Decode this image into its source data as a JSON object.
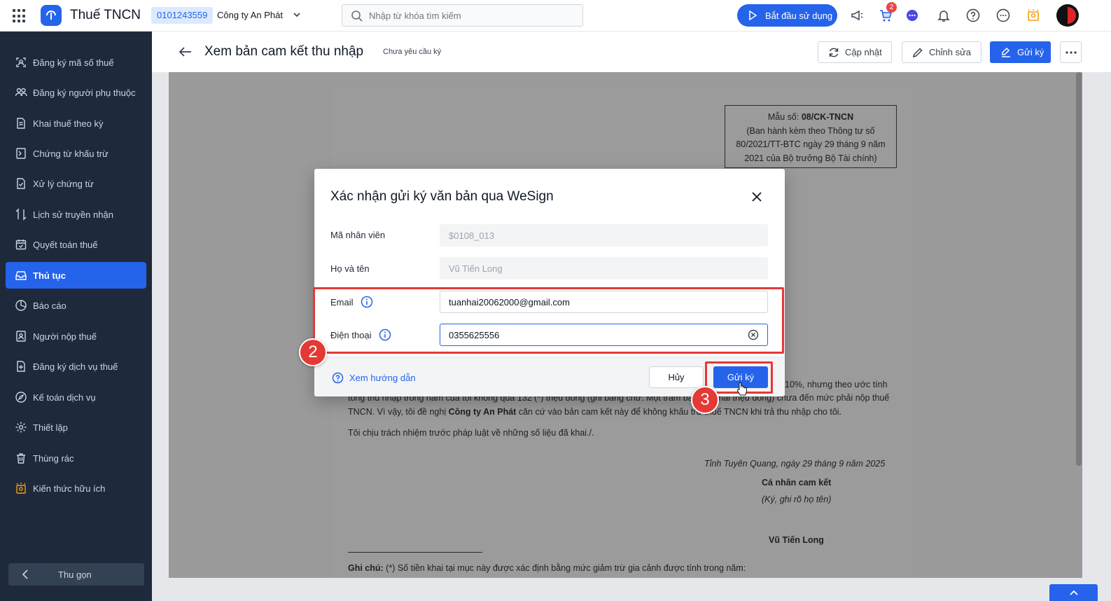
{
  "topbar": {
    "app_title": "Thuế TNCN",
    "tax_code": "0101243559",
    "company": "Công ty An Phát",
    "search_placeholder": "Nhập từ khóa tìm kiếm",
    "start_button": "Bắt đầu sử dụng",
    "cart_badge": "2"
  },
  "sidebar": {
    "items": [
      {
        "label": "Đăng ký mã số thuế",
        "icon": "user-id-icon"
      },
      {
        "label": "Đăng ký người phụ thuộc",
        "icon": "users-icon"
      },
      {
        "label": "Khai thuế theo kỳ",
        "icon": "document-icon"
      },
      {
        "label": "Chứng từ khấu trừ",
        "icon": "receipt-icon"
      },
      {
        "label": "Xử lý chứng từ",
        "icon": "document-check-icon"
      },
      {
        "label": "Lịch sử truyền nhận",
        "icon": "transfer-icon"
      },
      {
        "label": "Quyết toán thuế",
        "icon": "calendar-check-icon"
      },
      {
        "label": "Thủ tục",
        "icon": "inbox-icon",
        "active": true
      },
      {
        "label": "Báo cáo",
        "icon": "pie-chart-icon"
      },
      {
        "label": "Người nộp thuế",
        "icon": "person-card-icon"
      },
      {
        "label": "Đăng ký dịch vụ thuế",
        "icon": "document-plus-icon"
      },
      {
        "label": "Kế toán dịch vụ",
        "icon": "compass-icon"
      },
      {
        "label": "Thiết lập",
        "icon": "gear-icon"
      },
      {
        "label": "Thùng rác",
        "icon": "trash-icon"
      },
      {
        "label": "Kiến thức hữu ích",
        "icon": "lightbulb-icon"
      }
    ],
    "collapse_label": "Thu gọn"
  },
  "page": {
    "title": "Xem bản cam kết thu nhập",
    "status": "Chưa yêu cầu ký",
    "buttons": {
      "update": "Cập nhật",
      "edit": "Chỉnh sửa",
      "send_sign": "Gửi ký"
    }
  },
  "document": {
    "form_box": {
      "line1_prefix": "Mẫu số: ",
      "line1_code": "08/CK-TNCN",
      "line2": "(Ban hành kèm theo Thông tư số",
      "line3": "80/2021/TT-BTC ngày 29 tháng 9 năm",
      "line4": "2021 của Bộ trưởng Bộ Tài chính)"
    },
    "para_tail": "10%, nhưng theo ước tính",
    "line_partial": "tổng thu nhập trong năm của tôi không quá 132 (*) triệu đồng (ghi bằng chữ: Một trăm ba mươi hai triệu đồng) chưa đến mức phải nộp thuế",
    "line_tncn_a": "TNCN. Vì vậy, tôi đề nghị ",
    "line_tncn_company": "Công ty An Phát",
    "line_tncn_b": " căn cứ vào bản cam kết này để không khấu trừ thuế TNCN khi trả thu nhập cho tôi.",
    "responsibility": "Tôi chịu trách nhiệm trước pháp luật về những số liệu đã khai./.",
    "place_date": "Tỉnh Tuyên Quang, ngày 29 tháng 9 năm 2025",
    "signer_title": "Cá nhân cam kết",
    "signer_note": "(Ký, ghi rõ họ tên)",
    "signer_name": "Vũ Tiến Long",
    "note_label": "Ghi chú:",
    "note_text": " (*) Số tiền khai tại mục này được xác định bằng mức giảm trừ gia cảnh được tính trong năm:"
  },
  "modal": {
    "title": "Xác nhận gửi ký văn bản qua WeSign",
    "fields": {
      "employee_id_label": "Mã nhân viên",
      "employee_id_value": "$0108_013",
      "full_name_label": "Họ và tên",
      "full_name_value": "Vũ Tiến Long",
      "email_label": "Email",
      "email_value": "tuanhai20062000@gmail.com",
      "phone_label": "Điện thoại",
      "phone_value": "0355625556"
    },
    "help_link": "Xem hướng dẫn",
    "cancel": "Hủy",
    "send": "Gửi ký"
  },
  "annotations": {
    "step2": "2",
    "step3": "3"
  },
  "colors": {
    "accent": "#2563eb",
    "sidebar_bg": "#1e293b",
    "highlight": "#e53935"
  }
}
